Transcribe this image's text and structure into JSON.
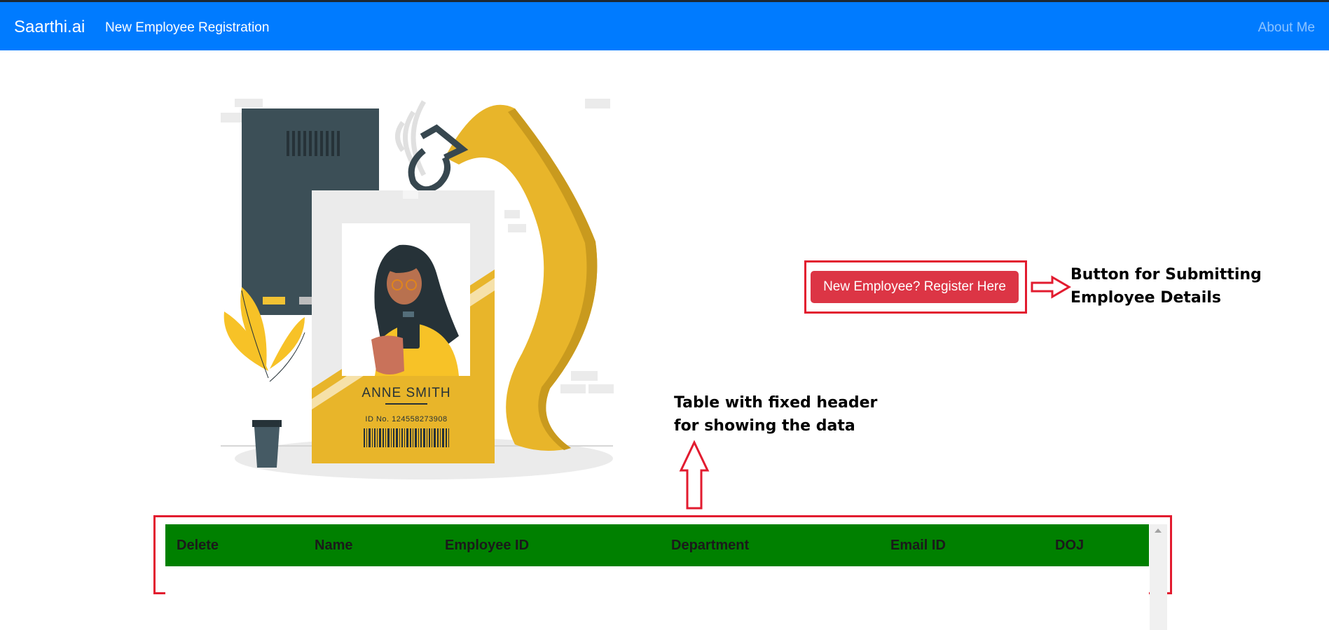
{
  "navbar": {
    "brand": "Saarthi.ai",
    "link": "New Employee Registration",
    "about": "About Me"
  },
  "illustration": {
    "badge_name": "ANNE SMITH",
    "badge_id": "ID No. 124558273908"
  },
  "register_button": "New Employee? Register Here",
  "annotations": {
    "button_line1": "Button for Submitting",
    "button_line2": "Employee Details",
    "table_line1": "Table with fixed header",
    "table_line2": "for showing the data"
  },
  "table": {
    "headers": [
      "Delete",
      "Name",
      "Employee ID",
      "Department",
      "Email ID",
      "DOJ"
    ],
    "rows": []
  },
  "colors": {
    "navbar": "#007bff",
    "button": "#dc3545",
    "table_header": "#008000",
    "annotation_border": "#e21b2f",
    "accent_yellow": "#e8b52a"
  }
}
